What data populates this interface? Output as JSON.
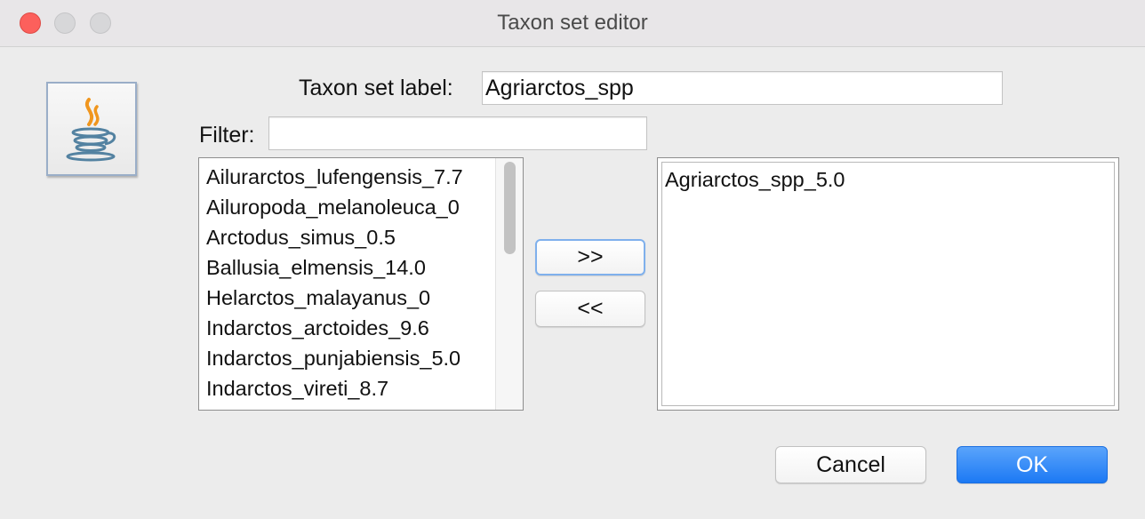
{
  "window": {
    "title": "Taxon set editor"
  },
  "icon": {
    "name": "java-coffee-cup-icon"
  },
  "label_field": {
    "label": "Taxon set label:",
    "value": "Agriarctos_spp"
  },
  "filter": {
    "label": "Filter:",
    "value": ""
  },
  "available_taxa": [
    "Ailurarctos_lufengensis_7.7",
    "Ailuropoda_melanoleuca_0",
    "Arctodus_simus_0.5",
    "Ballusia_elmensis_14.0",
    "Helarctos_malayanus_0",
    "Indarctos_arctoides_9.6",
    "Indarctos_punjabiensis_5.0",
    "Indarctos_vireti_8.7"
  ],
  "selected_taxa": [
    "Agriarctos_spp_5.0"
  ],
  "buttons": {
    "add": ">>",
    "remove": "<<",
    "cancel": "Cancel",
    "ok": "OK"
  },
  "colors": {
    "close": "#fc605c",
    "ok_button": "#1c79f4",
    "focus_ring": "#7fb0ec"
  }
}
